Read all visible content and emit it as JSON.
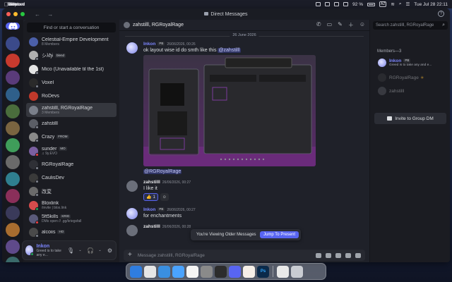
{
  "menubar": {
    "app_name": "Discord",
    "items": [
      "Edit",
      "View",
      "Window",
      "Help"
    ],
    "battery": "92 %",
    "input_source": "AZ",
    "datetime": "Tue Jul 28  22:11"
  },
  "window": {
    "title": "Direct Messages"
  },
  "servers": [
    {
      "color": "#3b4a8a",
      "badge": ""
    },
    {
      "color": "#c73a2e",
      "badge": ""
    },
    {
      "color": "#5a3b7a",
      "badge": ""
    },
    {
      "color": "#2f5f8a",
      "badge": ""
    },
    {
      "color": "#4a6d3c",
      "badge": ""
    },
    {
      "color": "#7a6440",
      "badge": ""
    },
    {
      "color": "#3f9d5a",
      "badge": ""
    },
    {
      "color": "#6a6a6a",
      "badge": ""
    },
    {
      "color": "#2f7f8f",
      "badge": ""
    },
    {
      "color": "#8a2f5a",
      "badge": ""
    },
    {
      "color": "#3a3a5a",
      "badge": ""
    },
    {
      "color": "#a86d2f",
      "badge": ""
    },
    {
      "color": "#5f4a8a",
      "badge": ""
    },
    {
      "color": "#3a6a6a",
      "badge": ""
    },
    {
      "color": "#6a3a3a",
      "badge": ""
    }
  ],
  "sidebar": {
    "find_placeholder": "Find or start a conversation",
    "dms": [
      {
        "name": "Celestial-Empire Development",
        "sub": "8 Members",
        "tag": "",
        "color": "#4b5fa8",
        "status": "none",
        "active": false
      },
      {
        "name": "シλђɨ",
        "sub": "",
        "tag": "blend",
        "color": "#b0b0b0",
        "status": "off",
        "active": false
      },
      {
        "name": "Mico (Unavailable til the 1st)",
        "sub": "",
        "tag": "",
        "color": "#e4e4e4",
        "status": "off",
        "active": false
      },
      {
        "name": "Voxel",
        "sub": "",
        "tag": "",
        "color": "#2a2a2a",
        "status": "off",
        "active": false
      },
      {
        "name": "RoDevs",
        "sub": "",
        "tag": "",
        "color": "#c0392b",
        "status": "none",
        "active": false
      },
      {
        "name": "zahstilll, RGRoyalRage",
        "sub": "3 Members",
        "tag": "",
        "color": "#7a7f8a",
        "status": "none",
        "active": true
      },
      {
        "name": "zahstilll",
        "sub": "",
        "tag": "",
        "color": "#5b5e66",
        "status": "off",
        "active": false
      },
      {
        "name": "Crazy",
        "sub": "",
        "tag": "FROM",
        "color": "#8a8a8a",
        "status": "off",
        "active": false
      },
      {
        "name": "sunder",
        "sub": "♫ 9y.EVO",
        "tag": "MO",
        "color": "#7a5fa0",
        "status": "dnd",
        "active": false
      },
      {
        "name": "RGRoyalRage",
        "sub": "",
        "tag": "",
        "color": "#2f3036",
        "status": "off",
        "active": false
      },
      {
        "name": "CaulisDev",
        "sub": "",
        "tag": "",
        "color": "#3a3a3a",
        "status": "off",
        "active": false
      },
      {
        "name": "改変",
        "sub": "",
        "tag": "",
        "color": "#6a6a6a",
        "status": "off",
        "active": false
      },
      {
        "name": "Bloxlink",
        "sub": "/invite | blox.link",
        "tag": "",
        "color": "#d64c4c",
        "status": "online",
        "active": false
      },
      {
        "name": "5ft5kills",
        "sub": "DMs open // .gg/kriegsfall",
        "tag": "KRIG",
        "color": "#5a5a7a",
        "status": "dnd",
        "active": false
      },
      {
        "name": "alcoiis",
        "sub": "",
        "tag": "HO",
        "color": "#4a4a4a",
        "status": "off",
        "active": false
      }
    ]
  },
  "user_panel": {
    "name": "Inkon",
    "status": "Greed is to take any e..."
  },
  "chat": {
    "header_name": "zahstilll, RGRoyalRage",
    "day_divider": "26 June 2026",
    "messages": [
      {
        "author": "Inkon",
        "tag": "PB",
        "time": "26/06/2026, 00:26",
        "text_pre": "ok layout wise id do smth like this ",
        "mention": "@zahstilll",
        "brand": true,
        "color": "#8a90ff"
      },
      {
        "author": "",
        "tag": "",
        "time": "",
        "text_pre": "",
        "mention": "@RGRoyalRage",
        "brand": false,
        "color": ""
      },
      {
        "author": "zahstilll",
        "tag": "",
        "time": "26/06/2026, 00:27",
        "text_pre": "I like it",
        "mention": "",
        "brand": false,
        "color": "#6b6f7a"
      },
      {
        "author": "Inkon",
        "tag": "PB",
        "time": "26/06/2026, 00:27",
        "text_pre": "for enchantments",
        "mention": "",
        "brand": true,
        "color": "#8a90ff"
      },
      {
        "author": "zahstilll",
        "tag": "",
        "time": "26/06/2026, 00:28",
        "text_pre": "",
        "mention": "",
        "brand": false,
        "color": "#6b6f7a"
      }
    ],
    "reaction": {
      "emoji": "👍",
      "count": "1"
    },
    "older_notice": "You're Viewing Older Messages",
    "jump_label": "Jump To Present",
    "composer_placeholder": "Message zahstilll, RGRoyalRage"
  },
  "members": {
    "search_placeholder": "Search zahstilll, RGRoyalRage",
    "header": "Members—3",
    "list": [
      {
        "name": "Inkon",
        "tag": "PB",
        "sub": "Greed is to take any and e...",
        "color": "#8a90ff",
        "dim": false,
        "brand": true
      },
      {
        "name": "RGRoyalRage",
        "tag": "★",
        "sub": "",
        "color": "#3a3b40",
        "dim": true,
        "brand": false
      },
      {
        "name": "zahstilll",
        "tag": "",
        "sub": "",
        "color": "#5b5e66",
        "dim": true,
        "brand": false
      }
    ],
    "invite_label": "Invite to Group DM"
  },
  "dock": {
    "apps": [
      {
        "name": "finder",
        "color": "#2f7de0",
        "label": ""
      },
      {
        "name": "launchpad",
        "color": "#e6e6e6",
        "label": ""
      },
      {
        "name": "safari",
        "color": "#3a8fe0",
        "label": ""
      },
      {
        "name": "mail",
        "color": "#4aa3ff",
        "label": ""
      },
      {
        "name": "chatgpt",
        "color": "#f5f5f5",
        "label": ""
      },
      {
        "name": "settings",
        "color": "#8a8a8a",
        "label": ""
      },
      {
        "name": "roblox",
        "color": "#2c2c2c",
        "label": ""
      },
      {
        "name": "discord",
        "color": "#5865f2",
        "label": ""
      },
      {
        "name": "claude",
        "color": "#f6efe8",
        "label": ""
      },
      {
        "name": "photoshop",
        "color": "#0b2a4a",
        "label": "Ps"
      },
      {
        "name": "document",
        "color": "#e9e9e9",
        "label": ""
      },
      {
        "name": "trash",
        "color": "#c9ccd2",
        "label": ""
      }
    ]
  }
}
